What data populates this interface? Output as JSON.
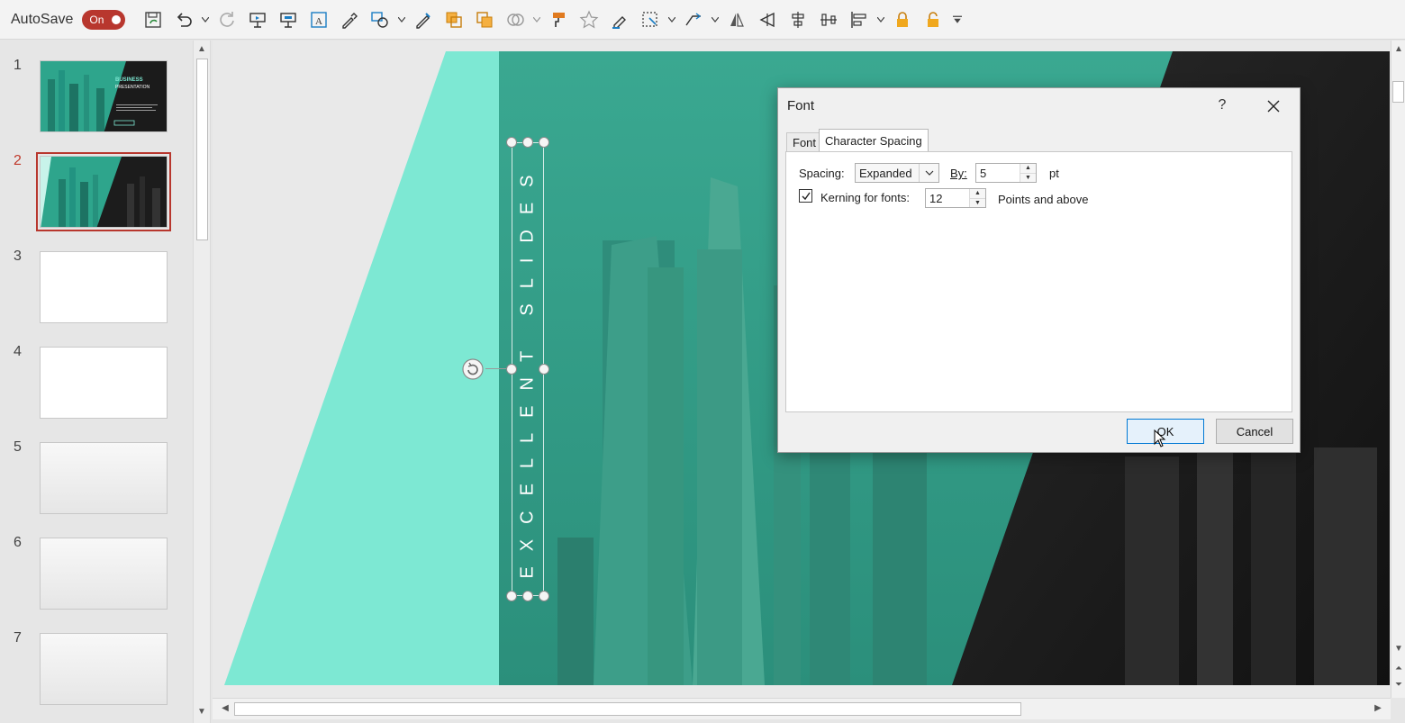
{
  "toolbar": {
    "autosave_label": "AutoSave",
    "toggle_label": "On",
    "icons": [
      "save-sync-icon",
      "undo-icon",
      "undo-dropdown",
      "redo-icon",
      "present-from-start-icon",
      "present-current-icon",
      "text-box-icon",
      "eyedropper-icon",
      "shapes-icon",
      "shapes-dropdown",
      "format-painter-pen-icon",
      "bring-forward-icon",
      "send-backward-icon",
      "merge-shapes-icon",
      "format-painter-icon",
      "star-icon",
      "highlighter-icon",
      "select-icon",
      "select-dropdown",
      "rotate-icon",
      "rotate-dropdown",
      "flip-icon",
      "align-left-triangle-icon",
      "align-center-icon",
      "distribute-icon",
      "align-icon",
      "align-dropdown",
      "lock-icon",
      "unlock-icon",
      "customize-toolbar-icon"
    ]
  },
  "slides": [
    {
      "number": "1"
    },
    {
      "number": "2"
    },
    {
      "number": "3"
    },
    {
      "number": "4"
    },
    {
      "number": "5"
    },
    {
      "number": "6"
    },
    {
      "number": "7"
    }
  ],
  "thumb1": {
    "title": "BUSINESS",
    "subtitle": "PRESENTATION"
  },
  "slide_text": "EXCELLENT SLIDES",
  "colors": {
    "accent": "#b8372e",
    "teal": "#7de8d3",
    "teal_dark": "#2a9d87"
  },
  "dialog": {
    "title": "Font",
    "help": "?",
    "tabs": {
      "font": "Font",
      "spacing": "Character Spacing"
    },
    "spacing_label": "Spacing:",
    "spacing_value": "Expanded",
    "by_label": "By:",
    "by_value": "5",
    "pt_label": "pt",
    "kerning_label": "Kerning for fonts:",
    "kerning_value": "12",
    "points_label": "Points and above",
    "kerning_checked": true,
    "ok": "OK",
    "cancel": "Cancel"
  }
}
